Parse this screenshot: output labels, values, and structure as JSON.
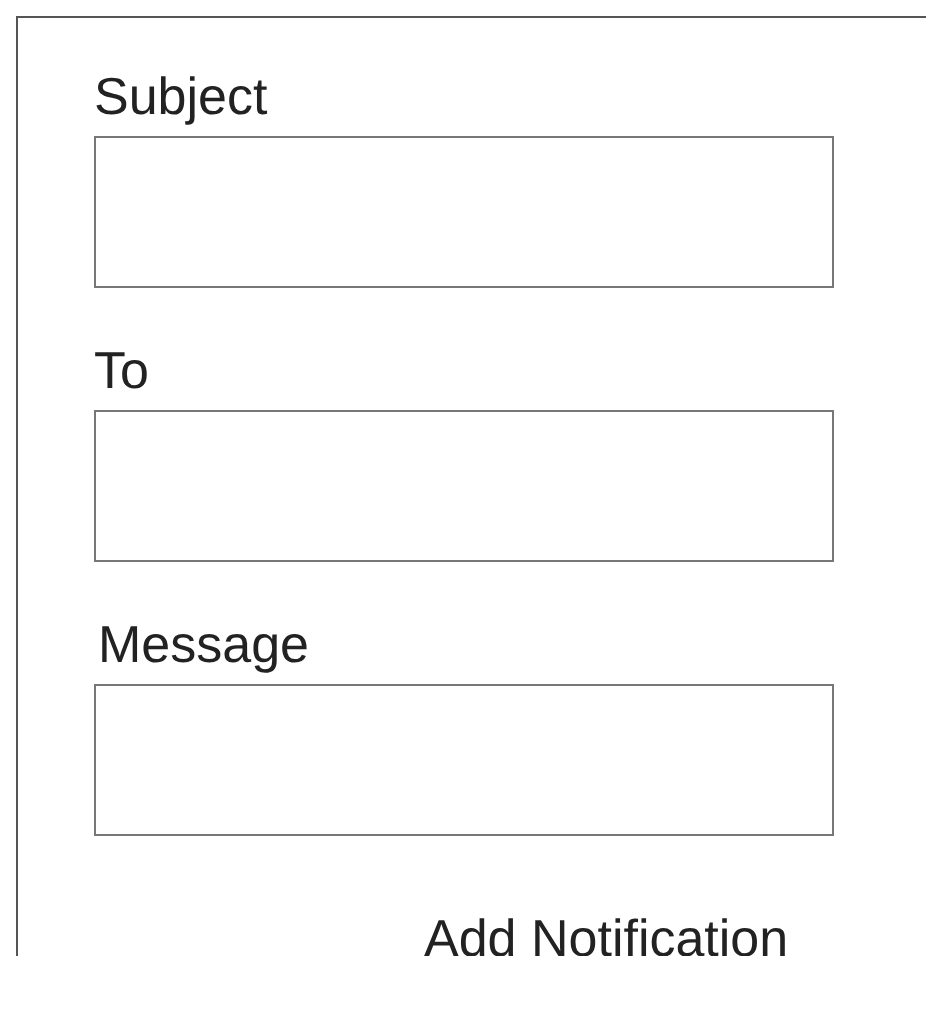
{
  "fields": [
    {
      "label": "Subject"
    },
    {
      "label": "To"
    },
    {
      "label": "Message"
    }
  ],
  "action": {
    "label": "Add Notification"
  }
}
